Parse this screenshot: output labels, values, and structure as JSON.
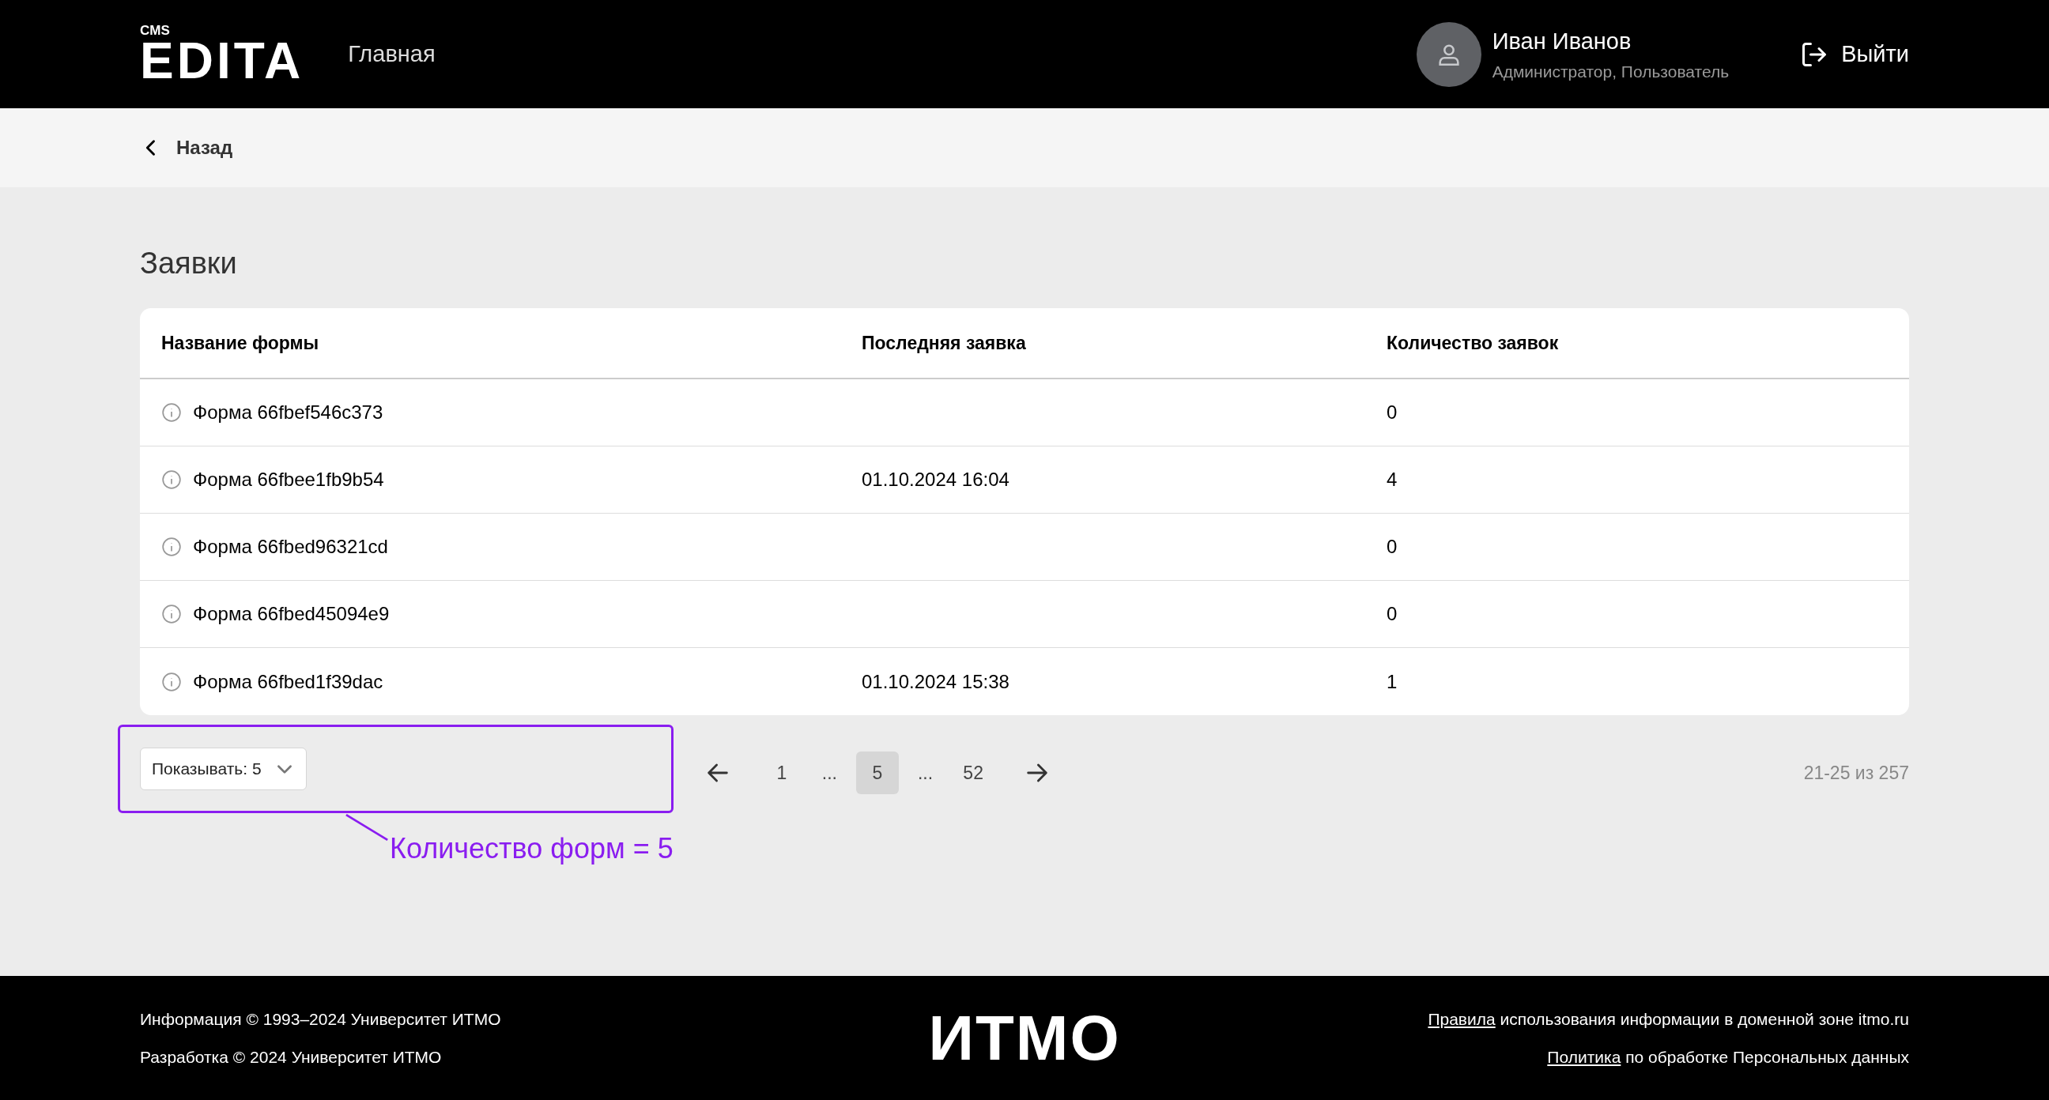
{
  "header": {
    "logo_small": "CMS",
    "logo": "EDITA",
    "nav": "Главная",
    "user": {
      "name": "Иван Иванов",
      "roles": "Администратор, Пользователь"
    },
    "logout": "Выйти"
  },
  "back": "Назад",
  "title": "Заявки",
  "table": {
    "columns": [
      "Название формы",
      "Последняя заявка",
      "Количество заявок"
    ],
    "rows": [
      {
        "name": "Форма 66fbef546c373",
        "last": "",
        "count": "0"
      },
      {
        "name": "Форма 66fbee1fb9b54",
        "last": "01.10.2024 16:04",
        "count": "4"
      },
      {
        "name": "Форма 66fbed96321cd",
        "last": "",
        "count": "0"
      },
      {
        "name": "Форма 66fbed45094e9",
        "last": "",
        "count": "0"
      },
      {
        "name": "Форма 66fbed1f39dac",
        "last": "01.10.2024 15:38",
        "count": "1"
      }
    ]
  },
  "pagination": {
    "page_size": "Показывать: 5",
    "pages": [
      {
        "kind": "page",
        "label": "1",
        "selected": false
      },
      {
        "kind": "ellipsis",
        "label": "..."
      },
      {
        "kind": "page",
        "label": "5",
        "selected": true
      },
      {
        "kind": "ellipsis",
        "label": "..."
      },
      {
        "kind": "page",
        "label": "52",
        "selected": false
      }
    ],
    "range": "21-25 из 257"
  },
  "annotation": "Количество форм = 5",
  "footer": {
    "left": [
      "Информация © 1993–2024 Университет ИТМО",
      "Разработка © 2024 Университет ИТМО"
    ],
    "logo": "ИТМО",
    "right": [
      {
        "link": "Правила",
        "text": "использования информации в доменной зоне itmo.ru"
      },
      {
        "link": "Политика",
        "text": "по обработке Персональных данных"
      }
    ]
  }
}
